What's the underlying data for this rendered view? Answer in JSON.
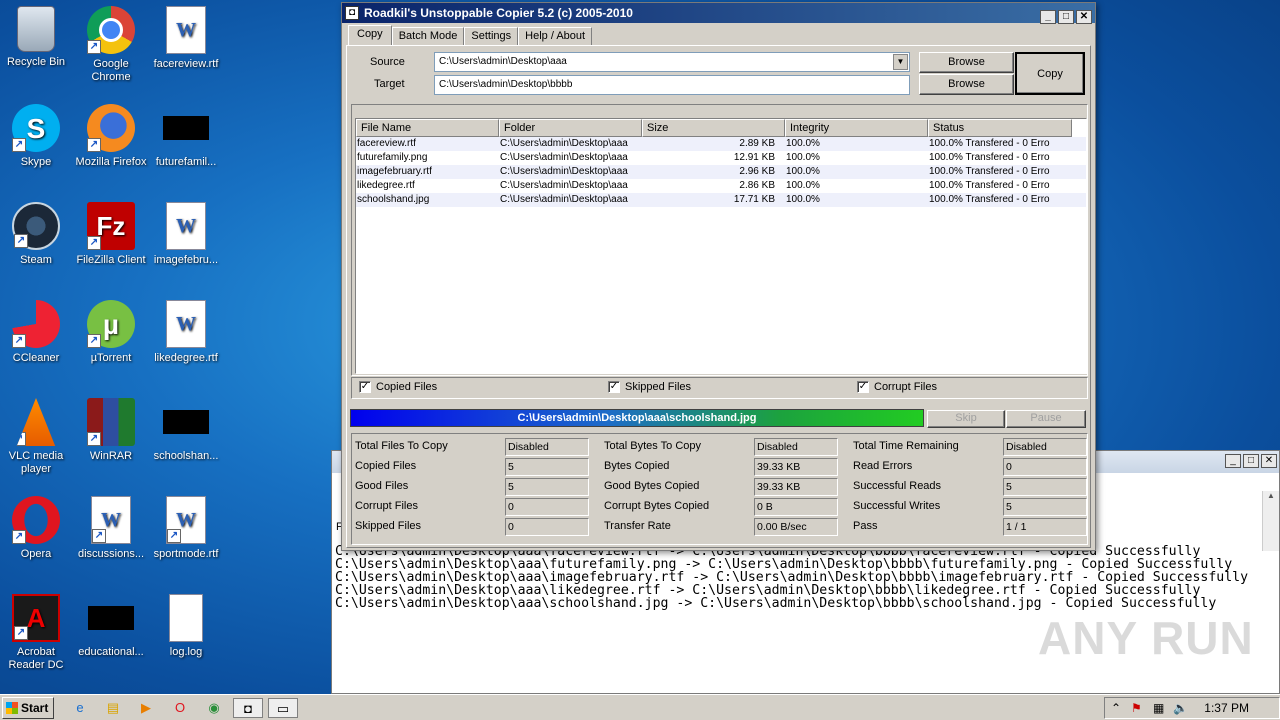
{
  "desktop": {
    "icons": [
      {
        "label": "Recycle Bin",
        "glyph": ""
      },
      {
        "label": "Google Chrome",
        "glyph": ""
      },
      {
        "label": "facereview.rtf",
        "glyph": "W"
      },
      {
        "label": "Skype",
        "glyph": "S"
      },
      {
        "label": "Mozilla Firefox",
        "glyph": ""
      },
      {
        "label": "futurefamil...",
        "glyph": ""
      },
      {
        "label": "Steam",
        "glyph": ""
      },
      {
        "label": "FileZilla Client",
        "glyph": "Fz"
      },
      {
        "label": "imagefebru...",
        "glyph": "W"
      },
      {
        "label": "CCleaner",
        "glyph": ""
      },
      {
        "label": "µTorrent",
        "glyph": "µ"
      },
      {
        "label": "likedegree.rtf",
        "glyph": "W"
      },
      {
        "label": "VLC media player",
        "glyph": ""
      },
      {
        "label": "WinRAR",
        "glyph": ""
      },
      {
        "label": "schoolshan...",
        "glyph": ""
      },
      {
        "label": "Opera",
        "glyph": ""
      },
      {
        "label": "discussions...",
        "glyph": "W"
      },
      {
        "label": "sportmode.rtf",
        "glyph": "W"
      },
      {
        "label": "Acrobat Reader DC",
        "glyph": "A"
      },
      {
        "label": "educational...",
        "glyph": ""
      },
      {
        "label": "log.log",
        "glyph": ""
      }
    ]
  },
  "copier": {
    "title": "Roadkil's Unstoppable Copier 5.2 (c) 2005-2010",
    "tabs": [
      "Copy",
      "Batch Mode",
      "Settings",
      "Help / About"
    ],
    "source_label": "Source",
    "target_label": "Target",
    "source_value": "C:\\Users\\admin\\Desktop\\aaa",
    "target_value": "C:\\Users\\admin\\Desktop\\bbbb",
    "browse_label": "Browse",
    "copy_label": "Copy",
    "columns": [
      "File Name",
      "Folder",
      "Size",
      "Integrity",
      "Status"
    ],
    "rows": [
      [
        "facereview.rtf",
        "C:\\Users\\admin\\Desktop\\aaa",
        "2.89 KB",
        "100.0%",
        "100.0% Transfered - 0 Erro"
      ],
      [
        "futurefamily.png",
        "C:\\Users\\admin\\Desktop\\aaa",
        "12.91 KB",
        "100.0%",
        "100.0% Transfered - 0 Erro"
      ],
      [
        "imagefebruary.rtf",
        "C:\\Users\\admin\\Desktop\\aaa",
        "2.96 KB",
        "100.0%",
        "100.0% Transfered - 0 Erro"
      ],
      [
        "likedegree.rtf",
        "C:\\Users\\admin\\Desktop\\aaa",
        "2.86 KB",
        "100.0%",
        "100.0% Transfered - 0 Erro"
      ],
      [
        "schoolshand.jpg",
        "C:\\Users\\admin\\Desktop\\aaa",
        "17.71 KB",
        "100.0%",
        "100.0% Transfered - 0 Erro"
      ]
    ],
    "checks": [
      {
        "label": "Copied Files",
        "checked": true
      },
      {
        "label": "Skipped Files",
        "checked": true
      },
      {
        "label": "Corrupt Files",
        "checked": true
      }
    ],
    "progress_text": "C:\\Users\\admin\\Desktop\\aaa\\schoolshand.jpg",
    "progress_fraction": 1.0,
    "skip_label": "Skip",
    "pause_label": "Pause",
    "stats": [
      [
        {
          "label": "Total Files To Copy",
          "value": "Disabled"
        },
        {
          "label": "Total Bytes To Copy",
          "value": "Disabled"
        },
        {
          "label": "Total Time Remaining",
          "value": "Disabled"
        }
      ],
      [
        {
          "label": "Copied Files",
          "value": "5"
        },
        {
          "label": "Bytes Copied",
          "value": "39.33 KB"
        },
        {
          "label": "Read Errors",
          "value": "0"
        }
      ],
      [
        {
          "label": "Good Files",
          "value": "5"
        },
        {
          "label": "Good Bytes Copied",
          "value": "39.33 KB"
        },
        {
          "label": "Successful Reads",
          "value": "5"
        }
      ],
      [
        {
          "label": "Corrupt Files",
          "value": "0"
        },
        {
          "label": "Corrupt Bytes Copied",
          "value": "0 B"
        },
        {
          "label": "Successful Writes",
          "value": "5"
        }
      ],
      [
        {
          "label": "Skipped Files",
          "value": "0"
        },
        {
          "label": "Transfer Rate",
          "value": "0.00 B/sec"
        },
        {
          "label": "Pass",
          "value": "1 / 1"
        }
      ]
    ]
  },
  "console": {
    "leading_char": "F",
    "lines": [
      "C:\\Users\\admin\\Desktop\\aaa\\facereview.rtf -> C:\\Users\\admin\\Desktop\\bbbb\\facereview.rtf - Copied Successfully",
      "C:\\Users\\admin\\Desktop\\aaa\\futurefamily.png -> C:\\Users\\admin\\Desktop\\bbbb\\futurefamily.png - Copied Successfully",
      "C:\\Users\\admin\\Desktop\\aaa\\imagefebruary.rtf -> C:\\Users\\admin\\Desktop\\bbbb\\imagefebruary.rtf - Copied Successfully",
      "C:\\Users\\admin\\Desktop\\aaa\\likedegree.rtf -> C:\\Users\\admin\\Desktop\\bbbb\\likedegree.rtf - Copied Successfully",
      "C:\\Users\\admin\\Desktop\\aaa\\schoolshand.jpg -> C:\\Users\\admin\\Desktop\\bbbb\\schoolshand.jpg - Copied Successfully"
    ]
  },
  "taskbar": {
    "start_label": "Start",
    "clock": "1:37 PM"
  },
  "watermark": "ANY RUN"
}
